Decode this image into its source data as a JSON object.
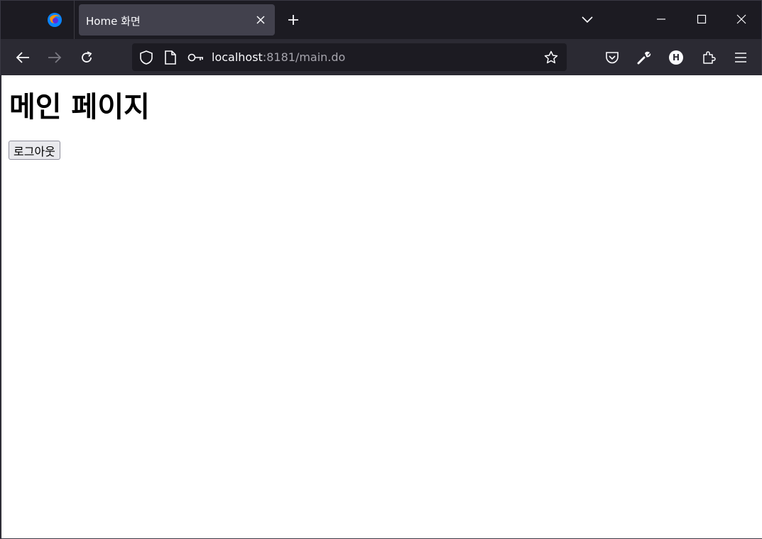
{
  "browser": {
    "tab": {
      "title": "Home 화면"
    },
    "url": {
      "host": "localhost",
      "path": ":8181/main.do"
    },
    "profile_initial": "H",
    "colors": {
      "chrome_dark": "#1c1b22",
      "toolbar": "#2b2a33",
      "tab_active": "#42414d",
      "text": "#fbfbfe"
    }
  },
  "page": {
    "heading": "메인 페이지",
    "logout_label": "로그아웃"
  }
}
